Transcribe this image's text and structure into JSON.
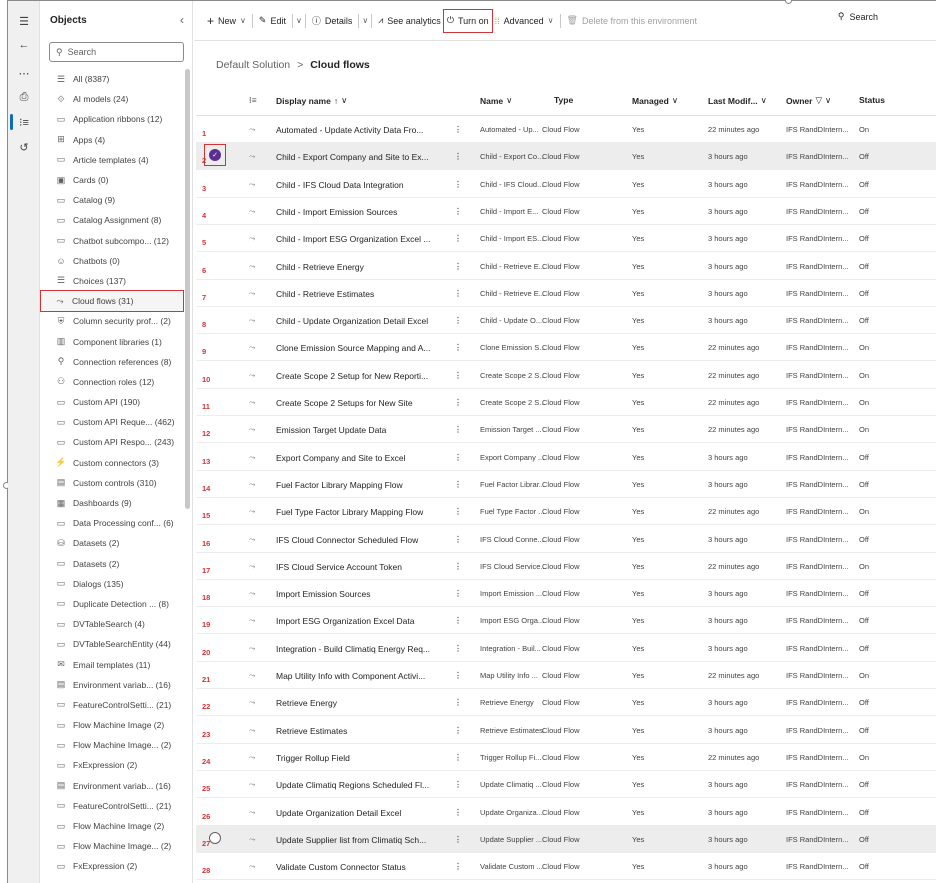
{
  "nav_rail": {
    "icons": [
      "menu-icon",
      "back-arrow-icon",
      "more-icon",
      "book-icon",
      "objects-icon",
      "history-icon"
    ]
  },
  "objects_panel": {
    "title": "Objects",
    "search_placeholder": "Search",
    "items": [
      {
        "icon": "list",
        "label": "All (8387)"
      },
      {
        "icon": "ai",
        "label": "AI models (24)"
      },
      {
        "icon": "folder",
        "label": "Application ribbons (12)"
      },
      {
        "icon": "apps",
        "label": "Apps (4)"
      },
      {
        "icon": "folder",
        "label": "Article templates (4)"
      },
      {
        "icon": "card",
        "label": "Cards (0)"
      },
      {
        "icon": "folder",
        "label": "Catalog (9)"
      },
      {
        "icon": "folder",
        "label": "Catalog Assignment (8)"
      },
      {
        "icon": "folder",
        "label": "Chatbot subcompo... (12)"
      },
      {
        "icon": "bot",
        "label": "Chatbots (0)"
      },
      {
        "icon": "list",
        "label": "Choices (137)"
      },
      {
        "icon": "flow",
        "label": "Cloud flows (31)"
      },
      {
        "icon": "security",
        "label": "Column security prof... (2)"
      },
      {
        "icon": "library",
        "label": "Component libraries (1)"
      },
      {
        "icon": "plug",
        "label": "Connection references (8)"
      },
      {
        "icon": "roles",
        "label": "Connection roles (12)"
      },
      {
        "icon": "folder",
        "label": "Custom API (190)"
      },
      {
        "icon": "folder",
        "label": "Custom API Reque... (462)"
      },
      {
        "icon": "folder",
        "label": "Custom API Respo... (243)"
      },
      {
        "icon": "connector",
        "label": "Custom connectors (3)"
      },
      {
        "icon": "control",
        "label": "Custom controls (310)"
      },
      {
        "icon": "dashboard",
        "label": "Dashboards (9)"
      },
      {
        "icon": "folder",
        "label": "Data Processing conf... (6)"
      },
      {
        "icon": "database",
        "label": "Datasets (2)"
      },
      {
        "icon": "folder",
        "label": "Datasets (2)"
      },
      {
        "icon": "dialog",
        "label": "Dialogs (135)"
      },
      {
        "icon": "folder",
        "label": "Duplicate Detection ... (8)"
      },
      {
        "icon": "folder",
        "label": "DVTableSearch (4)"
      },
      {
        "icon": "folder",
        "label": "DVTableSearchEntity (44)"
      },
      {
        "icon": "mail",
        "label": "Email templates (11)"
      },
      {
        "icon": "env",
        "label": "Environment variab... (16)"
      },
      {
        "icon": "folder",
        "label": "FeatureControlSetti... (21)"
      },
      {
        "icon": "folder",
        "label": "Flow Machine Image (2)"
      },
      {
        "icon": "folder",
        "label": "Flow Machine Image... (2)"
      },
      {
        "icon": "folder",
        "label": "FxExpression (2)"
      },
      {
        "icon": "env",
        "label": "Environment variab... (16)"
      },
      {
        "icon": "folder",
        "label": "FeatureControlSetti... (21)"
      },
      {
        "icon": "folder",
        "label": "Flow Machine Image (2)"
      },
      {
        "icon": "folder",
        "label": "Flow Machine Image... (2)"
      },
      {
        "icon": "folder",
        "label": "FxExpression (2)"
      }
    ],
    "selected_index": 11
  },
  "toolbar": {
    "new_label": "New",
    "edit_label": "Edit",
    "details_label": "Details",
    "analytics_label": "See analytics",
    "turn_on_label": "Turn on",
    "advanced_label": "Advanced",
    "delete_label": "Delete from this environment",
    "search_label": "Search"
  },
  "breadcrumb": {
    "parent": "Default Solution",
    "separator": ">",
    "current": "Cloud flows"
  },
  "grid": {
    "columns": {
      "display_name": "Display name",
      "name": "Name",
      "type": "Type",
      "managed": "Managed",
      "last_modified": "Last Modif...",
      "owner": "Owner",
      "status": "Status"
    },
    "rows": [
      {
        "num": "1",
        "display": "Automated - Update Activity Data Fro...",
        "name": "Automated - Up...",
        "type": "Cloud Flow",
        "managed": "Yes",
        "modified": "22 minutes ago",
        "owner": "IFS RandDIntern...",
        "status": "On"
      },
      {
        "num": "2",
        "display": "Child - Export Company and Site to Ex...",
        "name": "Child - Export Co...",
        "type": "Cloud Flow",
        "managed": "Yes",
        "modified": "3 hours ago",
        "owner": "IFS RandDIntern...",
        "status": "Off"
      },
      {
        "num": "3",
        "display": "Child - IFS Cloud Data Integration",
        "name": "Child - IFS Cloud...",
        "type": "Cloud Flow",
        "managed": "Yes",
        "modified": "3 hours ago",
        "owner": "IFS RandDIntern...",
        "status": "Off"
      },
      {
        "num": "4",
        "display": "Child - Import Emission Sources",
        "name": "Child - Import E...",
        "type": "Cloud Flow",
        "managed": "Yes",
        "modified": "3 hours ago",
        "owner": "IFS RandDIntern...",
        "status": "Off"
      },
      {
        "num": "5",
        "display": "Child - Import ESG Organization Excel ...",
        "name": "Child - Import ES...",
        "type": "Cloud Flow",
        "managed": "Yes",
        "modified": "3 hours ago",
        "owner": "IFS RandDIntern...",
        "status": "Off"
      },
      {
        "num": "6",
        "display": "Child - Retrieve Energy",
        "name": "Child - Retrieve E...",
        "type": "Cloud Flow",
        "managed": "Yes",
        "modified": "3 hours ago",
        "owner": "IFS RandDIntern...",
        "status": "Off"
      },
      {
        "num": "7",
        "display": "Child - Retrieve Estimates",
        "name": "Child - Retrieve E...",
        "type": "Cloud Flow",
        "managed": "Yes",
        "modified": "3 hours ago",
        "owner": "IFS RandDIntern...",
        "status": "Off"
      },
      {
        "num": "8",
        "display": "Child - Update Organization Detail Excel",
        "name": "Child - Update O...",
        "type": "Cloud Flow",
        "managed": "Yes",
        "modified": "3 hours ago",
        "owner": "IFS RandDIntern...",
        "status": "Off"
      },
      {
        "num": "9",
        "display": "Clone Emission Source Mapping and A...",
        "name": "Clone Emission S...",
        "type": "Cloud Flow",
        "managed": "Yes",
        "modified": "22 minutes ago",
        "owner": "IFS RandDIntern...",
        "status": "On"
      },
      {
        "num": "10",
        "display": "Create Scope 2 Setup for New Reporti...",
        "name": "Create Scope 2 S...",
        "type": "Cloud Flow",
        "managed": "Yes",
        "modified": "22 minutes ago",
        "owner": "IFS RandDIntern...",
        "status": "On"
      },
      {
        "num": "11",
        "display": "Create Scope 2 Setups for New Site",
        "name": "Create Scope 2 S...",
        "type": "Cloud Flow",
        "managed": "Yes",
        "modified": "22 minutes ago",
        "owner": "IFS RandDIntern...",
        "status": "On"
      },
      {
        "num": "12",
        "display": "Emission Target Update Data",
        "name": "Emission Target ...",
        "type": "Cloud Flow",
        "managed": "Yes",
        "modified": "22 minutes ago",
        "owner": "IFS RandDIntern...",
        "status": "On"
      },
      {
        "num": "13",
        "display": "Export Company and Site to Excel",
        "name": "Export Company ...",
        "type": "Cloud Flow",
        "managed": "Yes",
        "modified": "3 hours ago",
        "owner": "IFS RandDIntern...",
        "status": "Off"
      },
      {
        "num": "14",
        "display": "Fuel Factor Library Mapping Flow",
        "name": "Fuel Factor Librar...",
        "type": "Cloud Flow",
        "managed": "Yes",
        "modified": "3 hours ago",
        "owner": "IFS RandDIntern...",
        "status": "Off"
      },
      {
        "num": "15",
        "display": "Fuel Type Factor Library Mapping Flow",
        "name": "Fuel Type Factor ...",
        "type": "Cloud Flow",
        "managed": "Yes",
        "modified": "22 minutes ago",
        "owner": "IFS RandDIntern...",
        "status": "On"
      },
      {
        "num": "16",
        "display": "IFS Cloud Connector Scheduled Flow",
        "name": "IFS Cloud Conne...",
        "type": "Cloud Flow",
        "managed": "Yes",
        "modified": "3 hours ago",
        "owner": "IFS RandDIntern...",
        "status": "Off"
      },
      {
        "num": "17",
        "display": "IFS Cloud Service Account Token",
        "name": "IFS Cloud Service...",
        "type": "Cloud Flow",
        "managed": "Yes",
        "modified": "22 minutes ago",
        "owner": "IFS RandDIntern...",
        "status": "On"
      },
      {
        "num": "18",
        "display": "Import Emission Sources",
        "name": "Import Emission ...",
        "type": "Cloud Flow",
        "managed": "Yes",
        "modified": "3 hours ago",
        "owner": "IFS RandDIntern...",
        "status": "Off"
      },
      {
        "num": "19",
        "display": "Import ESG Organization Excel Data",
        "name": "Import ESG Orga...",
        "type": "Cloud Flow",
        "managed": "Yes",
        "modified": "3 hours ago",
        "owner": "IFS RandDIntern...",
        "status": "Off"
      },
      {
        "num": "20",
        "display": "Integration - Build Climatiq Energy Req...",
        "name": "Integration - Buil...",
        "type": "Cloud Flow",
        "managed": "Yes",
        "modified": "3 hours ago",
        "owner": "IFS RandDIntern...",
        "status": "Off"
      },
      {
        "num": "21",
        "display": "Map Utility Info with Component Activi...",
        "name": "Map Utility Info ...",
        "type": "Cloud Flow",
        "managed": "Yes",
        "modified": "22 minutes ago",
        "owner": "IFS RandDIntern...",
        "status": "On"
      },
      {
        "num": "22",
        "display": "Retrieve Energy",
        "name": "Retrieve Energy",
        "type": "Cloud Flow",
        "managed": "Yes",
        "modified": "3 hours ago",
        "owner": "IFS RandDIntern...",
        "status": "Off"
      },
      {
        "num": "23",
        "display": "Retrieve Estimates",
        "name": "Retrieve Estimates",
        "type": "Cloud Flow",
        "managed": "Yes",
        "modified": "3 hours ago",
        "owner": "IFS RandDIntern...",
        "status": "Off"
      },
      {
        "num": "24",
        "display": "Trigger Rollup Field",
        "name": "Trigger Rollup Fi...",
        "type": "Cloud Flow",
        "managed": "Yes",
        "modified": "22 minutes ago",
        "owner": "IFS RandDIntern...",
        "status": "On"
      },
      {
        "num": "25",
        "display": "Update Climatiq Regions Scheduled Fl...",
        "name": "Update Climatiq ...",
        "type": "Cloud Flow",
        "managed": "Yes",
        "modified": "3 hours ago",
        "owner": "IFS RandDIntern...",
        "status": "Off"
      },
      {
        "num": "26",
        "display": "Update Organization Detail Excel",
        "name": "Update Organiza...",
        "type": "Cloud Flow",
        "managed": "Yes",
        "modified": "3 hours ago",
        "owner": "IFS RandDIntern...",
        "status": "Off"
      },
      {
        "num": "27",
        "display": "Update Supplier list from Climatiq Sch...",
        "name": "Update Supplier ...",
        "type": "Cloud Flow",
        "managed": "Yes",
        "modified": "3 hours ago",
        "owner": "IFS RandDIntern...",
        "status": "Off"
      },
      {
        "num": "28",
        "display": "Validate Custom Connector Status",
        "name": "Validate Custom ...",
        "type": "Cloud Flow",
        "managed": "Yes",
        "modified": "3 hours ago",
        "owner": "IFS RandDIntern...",
        "status": "Off"
      }
    ],
    "selected_row": 1,
    "hover_row": 26
  },
  "colors": {
    "accent": "#0f6cbd",
    "highlight": "#d13438",
    "checked": "#5c2e91"
  }
}
